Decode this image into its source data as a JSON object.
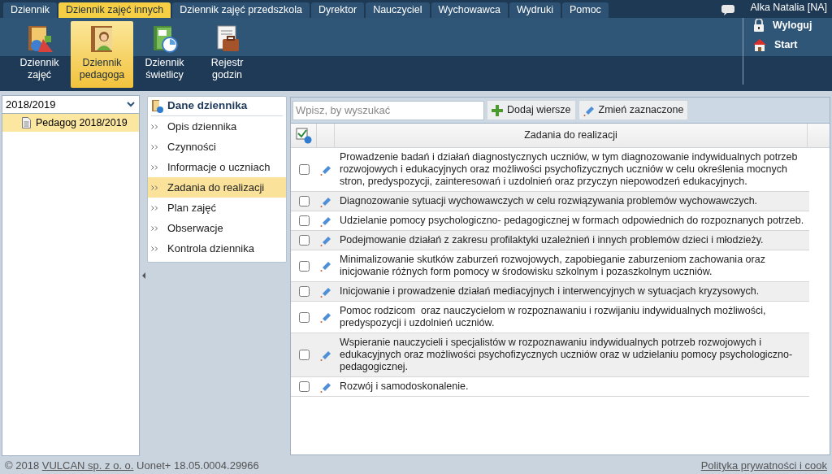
{
  "top_tabs": [
    {
      "label": "Dziennik",
      "selected": false
    },
    {
      "label": "Dziennik zajęć innych",
      "selected": true
    },
    {
      "label": "Dziennik zajęć przedszkola",
      "selected": false
    },
    {
      "label": "Dyrektor",
      "selected": false
    },
    {
      "label": "Nauczyciel",
      "selected": false
    },
    {
      "label": "Wychowawca",
      "selected": false
    },
    {
      "label": "Wydruki",
      "selected": false
    },
    {
      "label": "Pomoc",
      "selected": false
    }
  ],
  "user_name": "Alka Natalia [NA]",
  "toolbar": {
    "modules": [
      {
        "label": "Dziennik\nzajęć",
        "kind": "shapes",
        "selected": false
      },
      {
        "label": "Dziennik\npedagoga",
        "kind": "person",
        "selected": true
      },
      {
        "label": "Dziennik\nświetlicy",
        "kind": "clock",
        "selected": false
      },
      {
        "label": "Rejestr\ngodzin",
        "kind": "briefcase",
        "selected": false
      }
    ],
    "actions": [
      {
        "label": "Wyloguj",
        "kind": "lock"
      },
      {
        "label": "Start",
        "kind": "home"
      }
    ]
  },
  "left_panel": {
    "year_select": "2018/2019",
    "tree": [
      {
        "label": "Pedagog 2018/2019",
        "selected": true
      }
    ]
  },
  "nav": {
    "title": "Dane dziennika",
    "items": [
      {
        "label": "Opis dziennika",
        "selected": false
      },
      {
        "label": "Czynności",
        "selected": false
      },
      {
        "label": "Informacje o uczniach",
        "selected": false
      },
      {
        "label": "Zadania do realizacji",
        "selected": true
      },
      {
        "label": "Plan zajęć",
        "selected": false
      },
      {
        "label": "Obserwacje",
        "selected": false
      },
      {
        "label": "Kontrola dziennika",
        "selected": false
      }
    ]
  },
  "grid": {
    "search": {
      "placeholder": "Wpisz, by wyszukać"
    },
    "buttons": [
      {
        "label": "Dodaj wiersze",
        "kind": "add"
      },
      {
        "label": "Zmień zaznaczone",
        "kind": "edit"
      }
    ],
    "column": "Zadania do realizacji",
    "rows": [
      {
        "text": "Prowadzenie badań i działań diagnostycznych uczniów, w tym diagnozowanie indywidualnych potrzeb rozwojowych i edukacyjnych oraz możliwości psychofizycznych uczniów w celu określenia mocnych stron, predyspozycji, zainteresowań i uzdolnień oraz przyczyn niepowodzeń edukacyjnych.",
        "checked": false
      },
      {
        "text": "Diagnozowanie sytuacji wychowawczych w celu rozwiązywania problemów wychowawczych.",
        "checked": false
      },
      {
        "text": "Udzielanie pomocy psychologiczno- pedagogicznej w formach odpowiednich do rozpoznanych potrzeb.",
        "checked": false
      },
      {
        "text": "Podejmowanie działań z zakresu profilaktyki uzależnień i innych problemów dzieci i młodzieży.",
        "checked": false
      },
      {
        "text": "Minimalizowanie skutków zaburzeń rozwojowych, zapobieganie zaburzeniom zachowania oraz inicjowanie różnych form pomocy w środowisku szkolnym i pozaszkolnym uczniów.",
        "checked": false
      },
      {
        "text": "Inicjowanie i prowadzenie działań mediacyjnych i interwencyjnych w sytuacjach kryzysowych.",
        "checked": false
      },
      {
        "text": "Pomoc rodzicom  oraz nauczycielom w rozpoznawaniu i rozwijaniu indywidualnych możliwości, predyspozycji i uzdolnień uczniów.",
        "checked": false
      },
      {
        "text": "Wspieranie nauczycieli i specjalistów w rozpoznawaniu indywidualnych potrzeb rozwojowych i edukacyjnych oraz możliwości psychofizycznych uczniów oraz w udzielaniu pomocy psychologiczno-pedagogicznej.",
        "checked": false
      },
      {
        "text": "Rozwój i samodoskonalenie.",
        "checked": false
      }
    ]
  },
  "footer": {
    "copyright_prefix": "© 2018",
    "company_link": "VULCAN sp. z o. o.",
    "version": "Uonet+ 18.05.0004.29966",
    "privacy_link": "Polityka prywatności i cook"
  }
}
